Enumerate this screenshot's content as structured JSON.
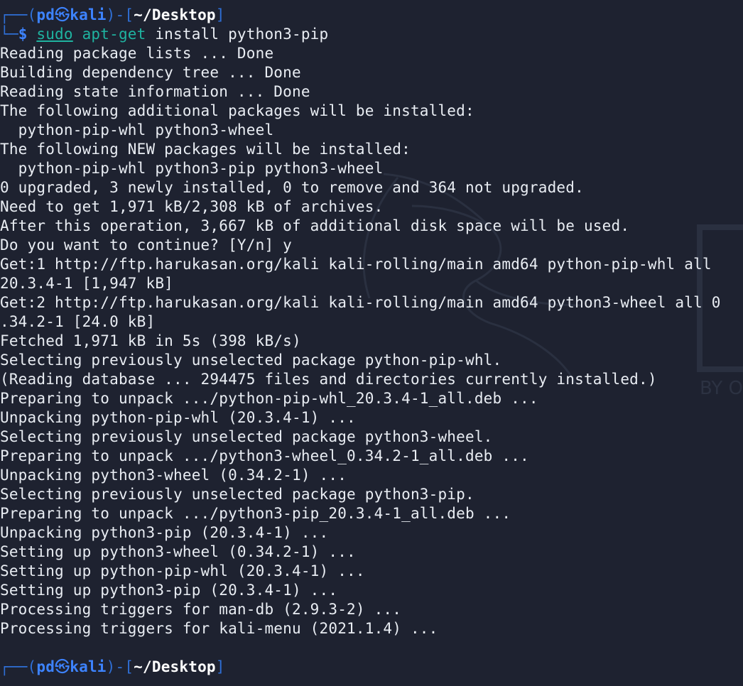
{
  "prompt": {
    "user": "pd",
    "skull_glyph": "㉿",
    "host": "kali",
    "dir": "~/Desktop",
    "dollar": "$"
  },
  "command": {
    "sudo": "sudo",
    "apt": "apt-get",
    "args": " install python3-pip"
  },
  "output_lines": [
    "Reading package lists ... Done",
    "Building dependency tree ... Done",
    "Reading state information ... Done",
    "The following additional packages will be installed:",
    "  python-pip-whl python3-wheel",
    "The following NEW packages will be installed:",
    "  python-pip-whl python3-pip python3-wheel",
    "0 upgraded, 3 newly installed, 0 to remove and 364 not upgraded.",
    "Need to get 1,971 kB/2,308 kB of archives.",
    "After this operation, 3,667 kB of additional disk space will be used.",
    "Do you want to continue? [Y/n] y",
    "Get:1 http://ftp.harukasan.org/kali kali-rolling/main amd64 python-pip-whl all",
    "20.3.4-1 [1,947 kB]",
    "Get:2 http://ftp.harukasan.org/kali kali-rolling/main amd64 python3-wheel all 0",
    ".34.2-1 [24.0 kB]",
    "Fetched 1,971 kB in 5s (398 kB/s)",
    "Selecting previously unselected package python-pip-whl.",
    "(Reading database ... 294475 files and directories currently installed.)",
    "Preparing to unpack .../python-pip-whl_20.3.4-1_all.deb ...",
    "Unpacking python-pip-whl (20.3.4-1) ...",
    "Selecting previously unselected package python3-wheel.",
    "Preparing to unpack .../python3-wheel_0.34.2-1_all.deb ...",
    "Unpacking python3-wheel (0.34.2-1) ...",
    "Selecting previously unselected package python3-pip.",
    "Preparing to unpack .../python3-pip_20.3.4-1_all.deb ...",
    "Unpacking python3-pip (20.3.4-1) ...",
    "Setting up python3-wheel (0.34.2-1) ...",
    "Setting up python-pip-whl (20.3.4-1) ...",
    "Setting up python3-pip (20.3.4-1) ...",
    "Processing triggers for man-db (2.9.3-2) ...",
    "Processing triggers for kali-menu (2021.1.4) ..."
  ],
  "watermark": {
    "text": "BY O"
  },
  "colors": {
    "background": "#1e2230",
    "prompt_frame": "#2f6fd6",
    "prompt_user": "#3d83ff",
    "command": "#1fb3a0",
    "text": "#e9edf3"
  }
}
